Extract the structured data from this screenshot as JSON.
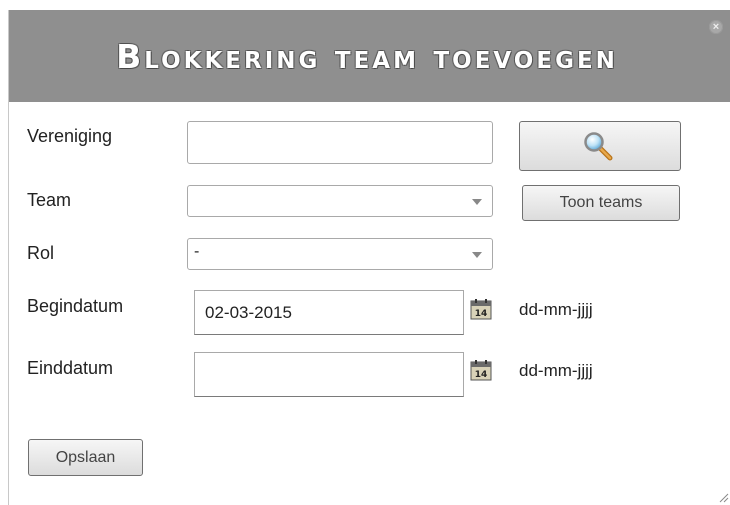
{
  "dialog": {
    "title": "Blokkering team toevoegen",
    "close_symbol": "×"
  },
  "form": {
    "vereniging": {
      "label": "Vereniging",
      "value": ""
    },
    "team": {
      "label": "Team",
      "value": ""
    },
    "rol": {
      "label": "Rol",
      "value": "-"
    },
    "begindatum": {
      "label": "Begindatum",
      "value": "02-03-2015",
      "format_hint": "dd-mm-jjjj"
    },
    "einddatum": {
      "label": "Einddatum",
      "value": "",
      "format_hint": "dd-mm-jjjj"
    },
    "calendar_day": "14"
  },
  "buttons": {
    "search_icon": "magnifier-icon",
    "toon_teams": "Toon teams",
    "opslaan": "Opslaan"
  }
}
